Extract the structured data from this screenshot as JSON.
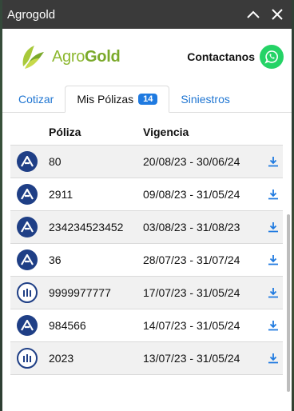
{
  "window": {
    "title": "Agrogold"
  },
  "header": {
    "logo_part1": "Agro",
    "logo_part2": "Gold",
    "contact_label": "Contactanos"
  },
  "tabs": [
    {
      "label": "Cotizar"
    },
    {
      "label": "Mis Pólizas",
      "badge": "14"
    },
    {
      "label": "Siniestros"
    }
  ],
  "table": {
    "headers": {
      "poliza": "Póliza",
      "vigencia": "Vigencia"
    },
    "rows": [
      {
        "insurer": "axa-icon",
        "poliza": "80",
        "vigencia": "20/08/23 - 30/06/24"
      },
      {
        "insurer": "axa-icon",
        "poliza": "2911",
        "vigencia": "09/08/23 - 31/05/24"
      },
      {
        "insurer": "axa-icon",
        "poliza": "234234523452",
        "vigencia": "03/08/23 - 31/08/23"
      },
      {
        "insurer": "axa-icon",
        "poliza": "36",
        "vigencia": "28/07/23 - 31/07/24"
      },
      {
        "insurer": "allianz-icon",
        "poliza": "9999977777",
        "vigencia": "17/07/23 - 31/05/24"
      },
      {
        "insurer": "axa-icon",
        "poliza": "984566",
        "vigencia": "14/07/23 - 31/05/24"
      },
      {
        "insurer": "allianz-icon",
        "poliza": "2023",
        "vigencia": "13/07/23 - 31/05/24"
      }
    ]
  },
  "colors": {
    "accent": "#1f7ae0",
    "brand_green": "#8db830",
    "titlebar": "#3a3a3a"
  }
}
